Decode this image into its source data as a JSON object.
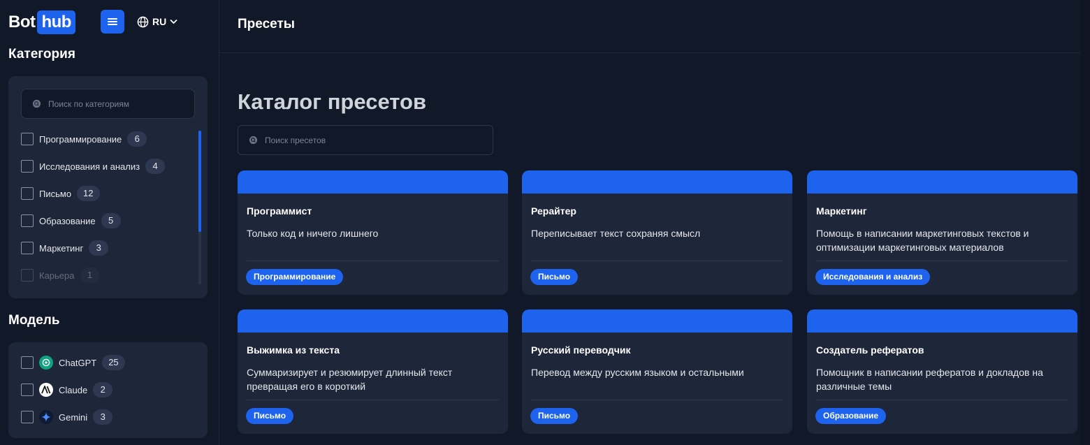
{
  "brand": {
    "part1": "Bot",
    "part2": "hub"
  },
  "lang": {
    "code": "RU"
  },
  "sidebar": {
    "category_title": "Категория",
    "category_search_placeholder": "Поиск по категориям",
    "categories": [
      {
        "label": "Программирование",
        "count": "6"
      },
      {
        "label": "Исследования и анализ",
        "count": "4"
      },
      {
        "label": "Письмо",
        "count": "12"
      },
      {
        "label": "Образование",
        "count": "5"
      },
      {
        "label": "Маркетинг",
        "count": "3"
      },
      {
        "label": "Карьера",
        "count": "1"
      }
    ],
    "model_title": "Модель",
    "models": [
      {
        "label": "ChatGPT",
        "count": "25",
        "icon": "chatgpt-icon"
      },
      {
        "label": "Claude",
        "count": "2",
        "icon": "claude-icon"
      },
      {
        "label": "Gemini",
        "count": "3",
        "icon": "gemini-icon"
      }
    ]
  },
  "header": {
    "title": "Пресеты"
  },
  "main": {
    "title": "Каталог пресетов",
    "search_placeholder": "Поиск пресетов",
    "cards": [
      {
        "title": "Программист",
        "desc": "Только код и ничего лишнего",
        "tag": "Программирование"
      },
      {
        "title": "Рерайтер",
        "desc": "Переписывает текст сохраняя смысл",
        "tag": "Письмо"
      },
      {
        "title": "Маркетинг",
        "desc": "Помощь в написании маркетинговых текстов и оптимизации маркетинговых материалов",
        "tag": "Исследования и анализ"
      },
      {
        "title": "Выжимка из текста",
        "desc": "Суммаризирует и резюмирует длинный текст превращая его в короткий",
        "tag": "Письмо"
      },
      {
        "title": "Русский переводчик",
        "desc": "Перевод между русским языком и остальными",
        "tag": "Письмо"
      },
      {
        "title": "Создатель рефератов",
        "desc": "Помощник в написании рефератов и докладов на различные темы",
        "tag": "Образование"
      }
    ]
  },
  "colors": {
    "accent": "#1d63ed",
    "background": "#111827",
    "panel": "#1e263a"
  }
}
